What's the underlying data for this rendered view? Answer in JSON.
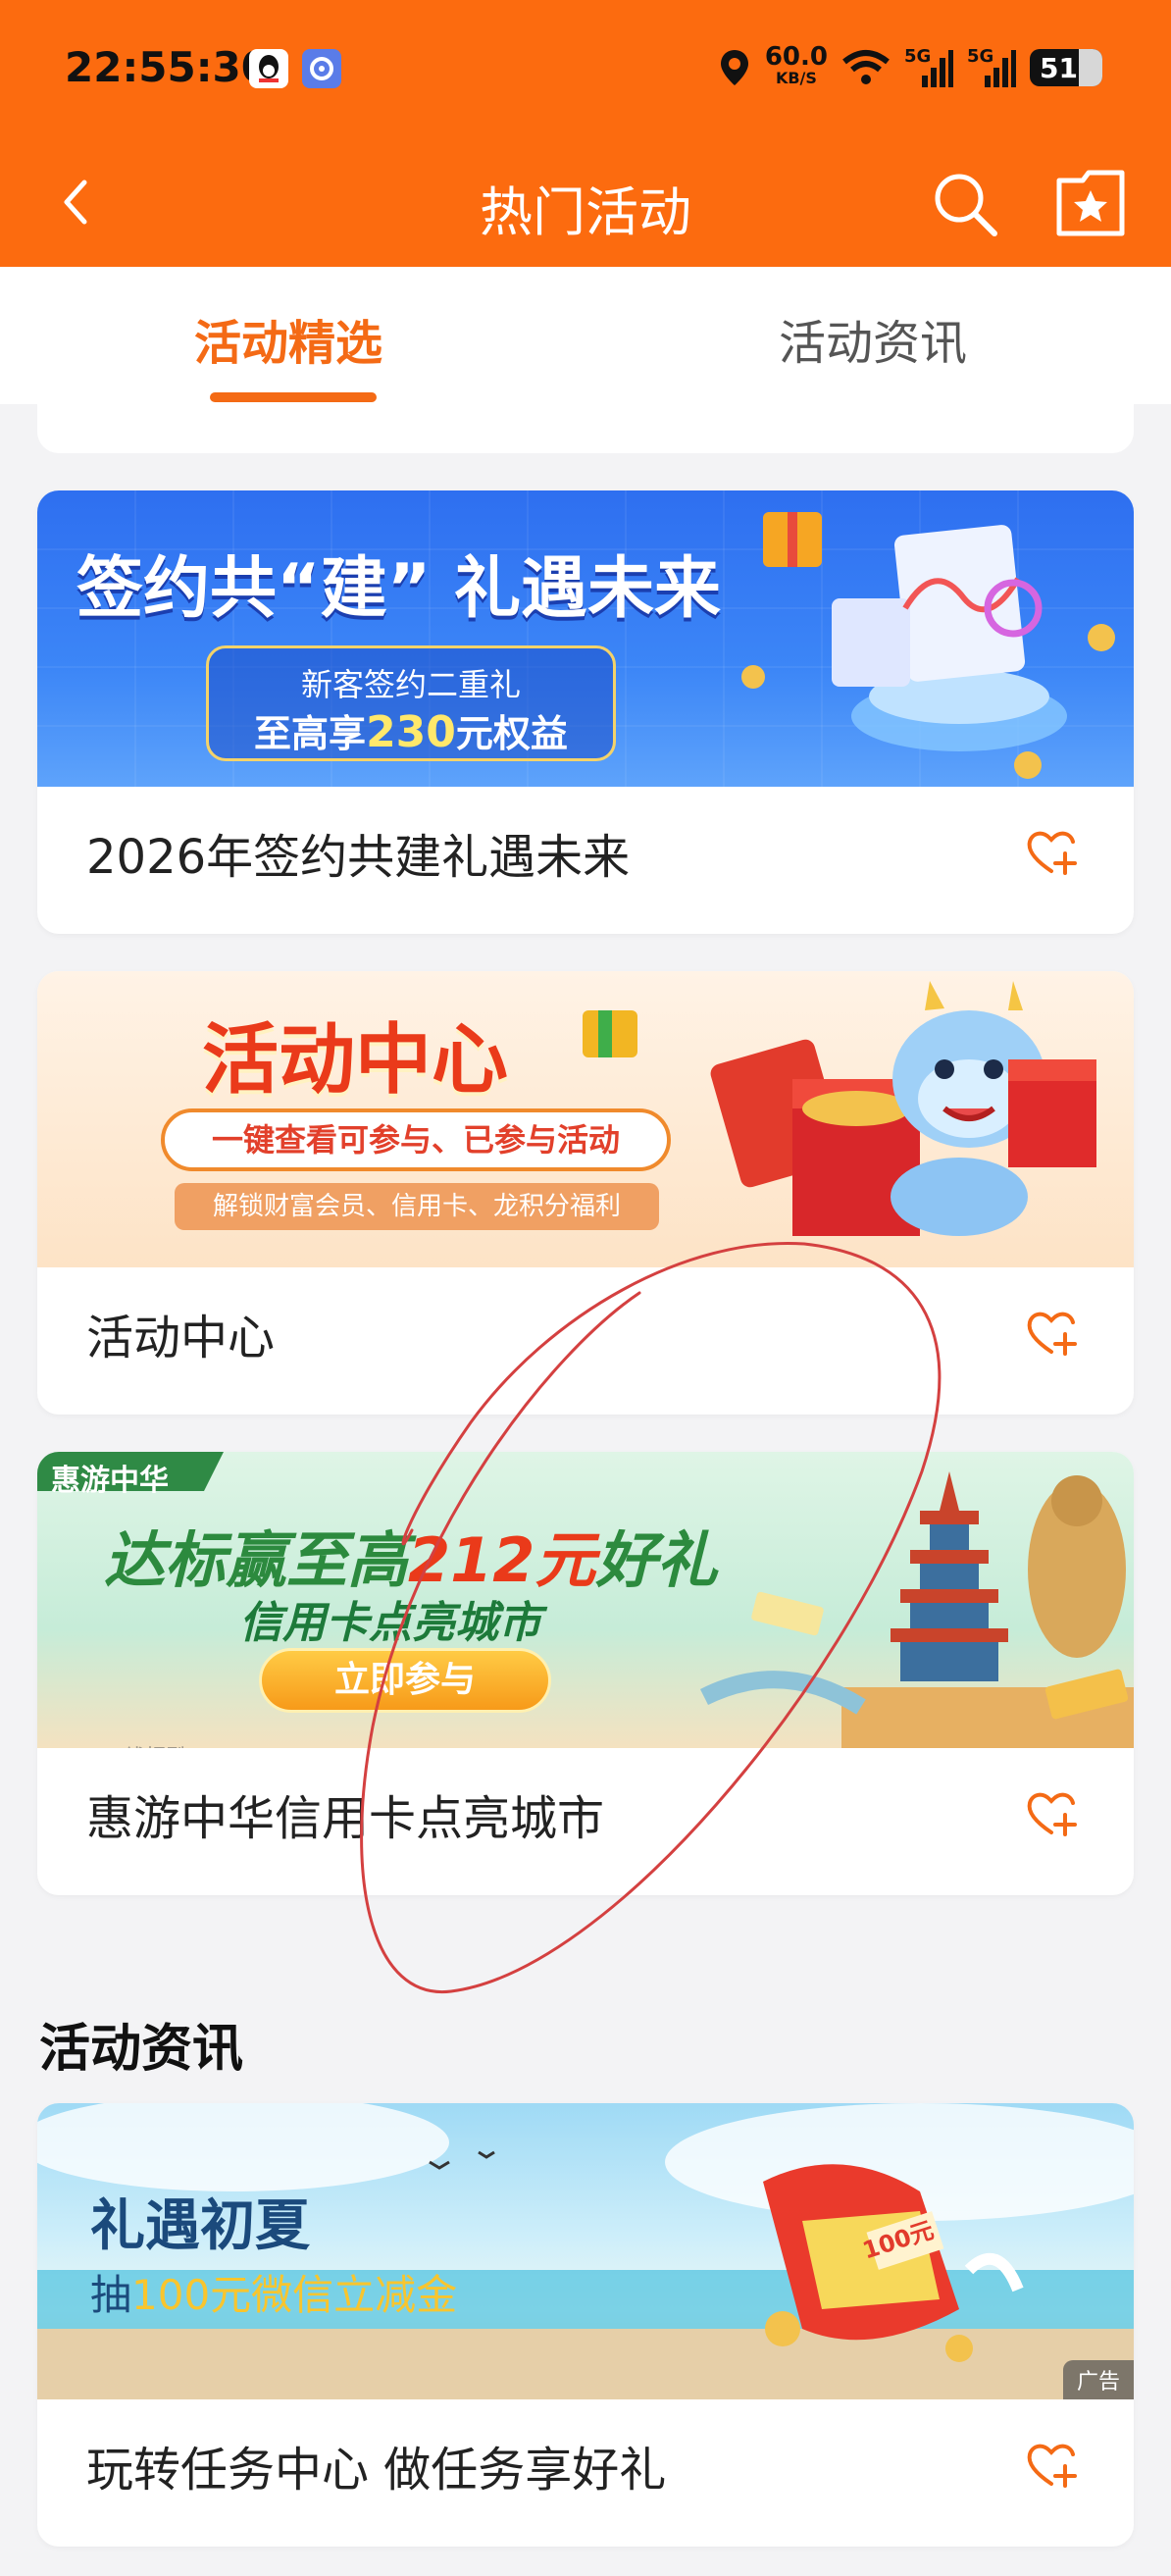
{
  "status_bar": {
    "time": "22:55:30",
    "network_speed_value": "60.0",
    "network_speed_unit": "KB/S",
    "signal_label_1": "5G",
    "signal_label_2": "5G",
    "battery_level": "51",
    "icons": [
      "qq-icon",
      "app-icon",
      "location-icon",
      "wifi-icon",
      "signal-icon",
      "signal-icon",
      "battery-icon"
    ]
  },
  "header": {
    "title": "热门活动",
    "back_icon": "chevron-left-icon",
    "search_icon": "search-icon",
    "favorites_icon": "star-folder-icon"
  },
  "tabs": [
    {
      "label": "活动精选",
      "active": true
    },
    {
      "label": "活动资讯",
      "active": false
    }
  ],
  "cards": [
    {
      "title": "2026年签约共建礼遇未来",
      "banner": {
        "headline": "签约共“建” 礼遇未来",
        "pill_line_1": "新客签约二重礼",
        "pill_line_2_prefix": "至高享",
        "pill_line_2_amount": "230",
        "pill_line_2_suffix": "元权益"
      },
      "fav_icon": "heart-plus-icon"
    },
    {
      "title": "活动中心",
      "banner": {
        "headline": "活动中心",
        "subline": "一键查看可参与、已参与活动",
        "footer": "解锁财富会员、信用卡、龙积分福利"
      },
      "fav_icon": "heart-plus-icon"
    },
    {
      "title": "惠游中华信用卡点亮城市",
      "banner": {
        "tag": "惠游中华",
        "headline_prefix": "达标赢至高",
        "headline_amount": "212元",
        "headline_suffix": "好礼",
        "subline": "信用卡点亮城市",
        "button": "立即参与",
        "watermark": "线报酷-new.xianbao.fun"
      },
      "fav_icon": "heart-plus-icon"
    }
  ],
  "news_section": {
    "title": "活动资讯",
    "card": {
      "title": "玩转任务中心 做任务享好礼",
      "banner": {
        "headline": "礼遇初夏",
        "subline_prefix": "抽",
        "subline_amount": "100元微信立减金",
        "envelope_amount": "100元",
        "ad_label": "广告"
      },
      "fav_icon": "heart-plus-icon"
    }
  },
  "colors": {
    "brand_orange": "#fc6b0f",
    "tab_active": "#f46a15",
    "scribble_red": "#d44040"
  }
}
